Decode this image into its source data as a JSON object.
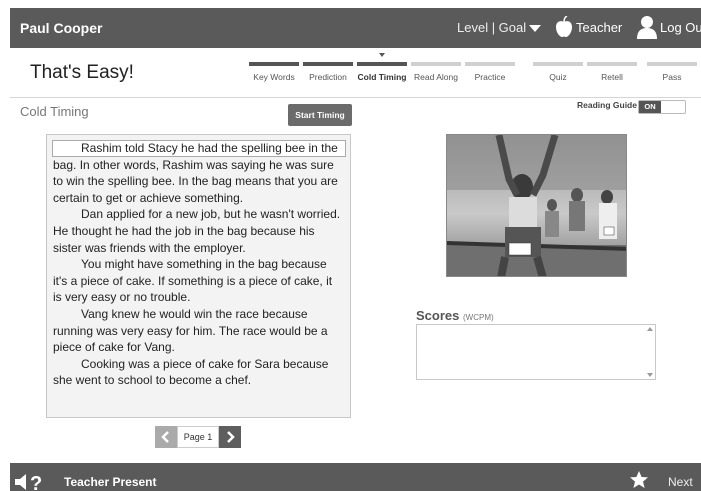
{
  "topbar": {
    "user_name": "Paul Cooper",
    "level_goal": "Level | Goal",
    "teacher": "Teacher",
    "logout": "Log Out"
  },
  "header": {
    "title": "That's Easy!",
    "steps": [
      {
        "label": "Key Words",
        "state": "done"
      },
      {
        "label": "Prediction",
        "state": "done"
      },
      {
        "label": "Cold Timing",
        "state": "active"
      },
      {
        "label": "Read Along",
        "state": "todo"
      },
      {
        "label": "Practice",
        "state": "todo"
      },
      {
        "label": "Quiz",
        "state": "todo"
      },
      {
        "label": "Retell",
        "state": "todo"
      },
      {
        "label": "Pass",
        "state": "todo"
      }
    ]
  },
  "main": {
    "section_title": "Cold Timing",
    "start_timing": "Start Timing",
    "reading_guide_label": "Reading Guide",
    "reading_guide_state": "ON",
    "passage": [
      "Rashim told Stacy he had the spelling bee in the bag. In other words, Rashim was saying he was sure to win the spelling bee. In the bag means that you are certain to get or achieve something.",
      "Dan applied for a new job, but he wasn't worried. He thought he had the job in the bag because his sister was friends with the employer.",
      "You might have something in the bag because it's a piece of cake. If something is a piece of cake, it is very easy or no trouble.",
      "Vang knew he would win the race because running was very easy for him. The race would be a piece of cake for Vang.",
      "Cooking was a piece of cake for Sara because she went to school to become a chef."
    ],
    "pager": {
      "label": "Page 1"
    },
    "scores": {
      "title": "Scores",
      "unit": "(WCPM)"
    }
  },
  "bottombar": {
    "teacher_present": "Teacher Present",
    "next": "Next"
  },
  "colors": {
    "bar": "#5a5a5a",
    "passage_bg": "#f3f3f3"
  }
}
